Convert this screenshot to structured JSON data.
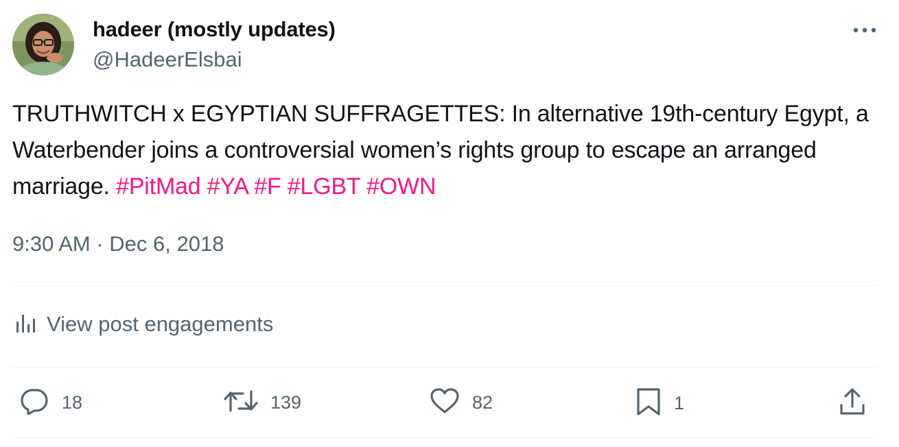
{
  "author": {
    "display_name": "hadeer (mostly updates)",
    "handle": "@HadeerElsbai"
  },
  "post": {
    "text": "TRUTHWITCH x EGYPTIAN SUFFRAGETTES: In alternative 19th-century Egypt, a Waterbender joins a controversial women’s rights group to escape an arranged marriage. ",
    "hashtags": [
      "#PitMad",
      "#YA",
      "#F",
      "#LGBT",
      "#OWN"
    ],
    "timestamp": "9:30 AM · Dec 6, 2018"
  },
  "engagements_link": "View post engagements",
  "actions": {
    "replies": "18",
    "reposts": "139",
    "likes": "82",
    "bookmarks": "1"
  },
  "colors": {
    "text_primary": "#0f1419",
    "text_secondary": "#536471",
    "hashtag": "#f91880",
    "divider": "#eff3f4"
  },
  "icons": [
    "more-icon",
    "analytics-icon",
    "reply-icon",
    "repost-icon",
    "like-icon",
    "bookmark-icon",
    "share-icon"
  ]
}
